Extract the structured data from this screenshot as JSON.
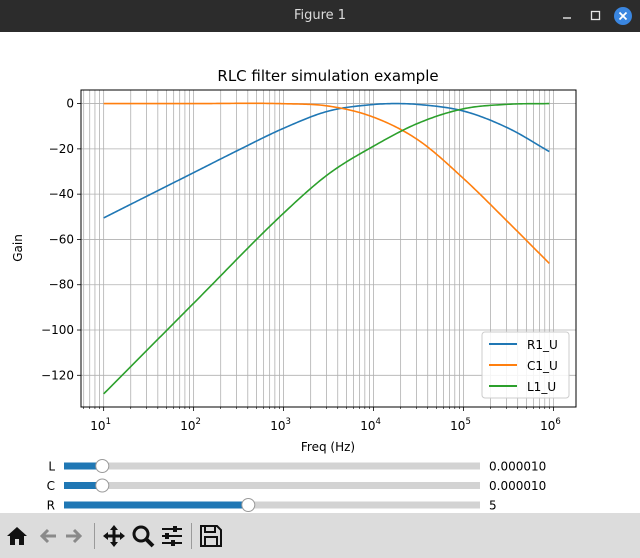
{
  "window": {
    "title": "Figure 1"
  },
  "chart_data": {
    "type": "line",
    "title": "RLC filter simulation example",
    "xlabel": "Freq (Hz)",
    "ylabel": "Gain",
    "xscale": "log",
    "xlim": [
      5.6,
      1780000
    ],
    "ylim": [
      -134,
      6
    ],
    "x_ticks": [
      10,
      100,
      1000,
      10000,
      100000,
      1000000
    ],
    "x_tick_labels": [
      {
        "base": "10",
        "exp": "1"
      },
      {
        "base": "10",
        "exp": "2"
      },
      {
        "base": "10",
        "exp": "3"
      },
      {
        "base": "10",
        "exp": "4"
      },
      {
        "base": "10",
        "exp": "5"
      },
      {
        "base": "10",
        "exp": "6"
      }
    ],
    "y_ticks": [
      0,
      -20,
      -40,
      -60,
      -80,
      -100,
      -120
    ],
    "y_tick_labels": [
      "0",
      "−20",
      "−40",
      "−60",
      "−80",
      "−100",
      "−120"
    ],
    "grid": "both (major and minor)",
    "legend_position": "lower right",
    "series": [
      {
        "name": "R1_U",
        "color": "#1f77b4",
        "x": [
          10,
          31.6,
          100,
          316,
          1000,
          3162,
          10000,
          17800,
          31600,
          100000,
          316000,
          900000
        ],
        "y": [
          -50.5,
          -40.5,
          -30.5,
          -20.5,
          -10.9,
          -3.3,
          -0.4,
          0,
          -0.4,
          -3.3,
          -10.9,
          -21.2
        ]
      },
      {
        "name": "C1_U",
        "color": "#ff7f0e",
        "x": [
          10,
          100,
          1000,
          3162,
          10000,
          31600,
          100000,
          316000,
          900000
        ],
        "y": [
          0,
          0,
          -0.05,
          -1.1,
          -6.0,
          -16.2,
          -33.1,
          -52.5,
          -70.6
        ]
      },
      {
        "name": "L1_U",
        "color": "#2ca02c",
        "x": [
          10,
          100,
          1000,
          3162,
          10000,
          31600,
          100000,
          316000,
          900000
        ],
        "y": [
          -128.2,
          -88.2,
          -48.4,
          -31.1,
          -18.8,
          -8.6,
          -2.3,
          -0.3,
          0
        ]
      }
    ]
  },
  "sliders": [
    {
      "label": "L",
      "value_text": "0.000010",
      "fraction": 0.092
    },
    {
      "label": "C",
      "value_text": "0.000010",
      "fraction": 0.092
    },
    {
      "label": "R",
      "value_text": "5",
      "fraction": 0.443
    }
  ],
  "slider_colors": {
    "fill": "#1f77b4",
    "track": "#d3d3d3"
  },
  "toolbar": {
    "items": [
      "home-icon",
      "back-icon",
      "forward-icon",
      "pan-icon",
      "zoom-icon",
      "configure-subplots-icon",
      "save-icon"
    ]
  }
}
